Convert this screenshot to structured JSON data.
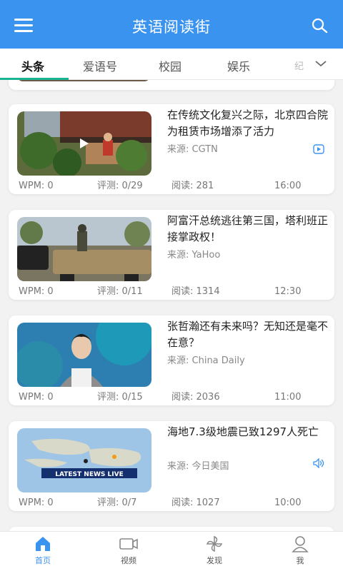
{
  "app": {
    "title": "英语阅读街"
  },
  "tabs": [
    {
      "label": "头条",
      "active": true
    },
    {
      "label": "爱语号"
    },
    {
      "label": "校园"
    },
    {
      "label": "娱乐"
    },
    {
      "label": "纪"
    }
  ],
  "articles": [
    {
      "title": "在传统文化复兴之际，北京四合院为租赁市场增添了活力",
      "source": "来源: CGTN",
      "badge": "video-icon",
      "wpm": "WPM: 0",
      "quiz": "评测: 0/29",
      "reads": "阅读: 281",
      "time": "16:00"
    },
    {
      "title": "阿富汗总统逃往第三国，塔利班正接掌政权！",
      "source": "来源: YaHoo",
      "badge": "",
      "wpm": "WPM: 0",
      "quiz": "评测: 0/11",
      "reads": "阅读: 1314",
      "time": "12:30"
    },
    {
      "title": "张哲瀚还有未来吗？无知还是毫不在意？",
      "source": "来源: China Daily",
      "badge": "",
      "wpm": "WPM: 0",
      "quiz": "评测: 0/15",
      "reads": "阅读: 2036",
      "time": "11:00"
    },
    {
      "title": "海地7.3级地震已致1297人死亡",
      "source": "来源: 今日美国",
      "badge": "audio-icon",
      "thumb_text": "LATEST NEWS LIVE",
      "wpm": "WPM: 0",
      "quiz": "评测: 0/7",
      "reads": "阅读: 1027",
      "time": "10:00"
    }
  ],
  "bottom_nav": [
    {
      "label": "首页",
      "icon": "home-icon",
      "active": true
    },
    {
      "label": "视频",
      "icon": "video-camera-icon"
    },
    {
      "label": "发现",
      "icon": "pinwheel-icon"
    },
    {
      "label": "我",
      "icon": "profile-icon"
    }
  ],
  "colors": {
    "primary": "#3b93f0",
    "tab_indicator": "#1ab394"
  }
}
